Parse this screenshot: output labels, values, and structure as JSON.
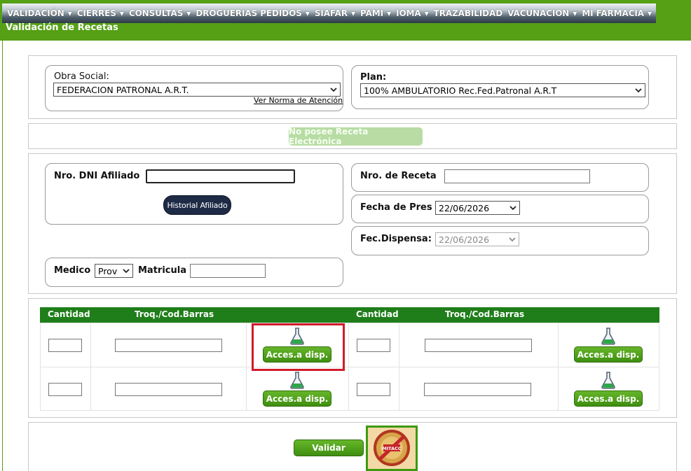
{
  "menu": [
    {
      "label": "VALIDACIÓN",
      "has_dropdown": true
    },
    {
      "label": "CIERRES",
      "has_dropdown": true
    },
    {
      "label": "CONSULTAS",
      "has_dropdown": true
    },
    {
      "label": "DROGUERIAS PEDIDOS",
      "has_dropdown": true
    },
    {
      "label": "SIAFAR",
      "has_dropdown": true
    },
    {
      "label": "PAMI",
      "has_dropdown": true
    },
    {
      "label": "IOMA",
      "has_dropdown": true
    },
    {
      "label": "TRAZABILIDAD",
      "has_dropdown": false
    },
    {
      "label": "VACUNACION",
      "has_dropdown": true
    },
    {
      "label": "MI FARMACIA",
      "has_dropdown": true
    }
  ],
  "page_title": "Validación de Recetas",
  "obra_social": {
    "label": "Obra Social:",
    "selected": "FEDERACION PATRONAL A.R.T.",
    "link": "Ver Norma de Atención"
  },
  "plan": {
    "label": "Plan:",
    "selected": "100% AMBULATORIO Rec.Fed.Patronal A.R.T"
  },
  "receta_electronica_button": "No posee Receta Electrónica",
  "afiliado": {
    "dni_label": "Nro. DNI Afiliado",
    "dni_value": "",
    "historial_button": "Historial Afiliado"
  },
  "receta": {
    "nro_label": "Nro. de Receta",
    "nro_value": "",
    "fecha_pres_label": "Fecha de Pres",
    "fecha_pres_value": "22/06/2026",
    "fec_dispensa_label": "Fec.Dispensa:",
    "fec_dispensa_value": "22/06/2026"
  },
  "medico": {
    "label": "Medico",
    "tipo_selected": "Prov",
    "matricula_label": "Matricula",
    "matricula_value": ""
  },
  "grid": {
    "headers": [
      "Cantidad",
      "Troq./Cod.Barras",
      "",
      "Cantidad",
      "Troq./Cod.Barras",
      ""
    ],
    "acces_button": "Acces.a disp.",
    "rows": [
      {
        "left": {
          "cantidad": "",
          "troquel": ""
        },
        "right": {
          "cantidad": "",
          "troquel": ""
        }
      },
      {
        "left": {
          "cantidad": "",
          "troquel": ""
        },
        "right": {
          "cantidad": "",
          "troquel": ""
        }
      }
    ]
  },
  "footer": {
    "validar_button": "Validar",
    "logo_text": "MITACC"
  },
  "colors": {
    "brand_green": "#55a015",
    "grid_header": "#1f7e1a",
    "button_green": "#4a9c19",
    "navy_button": "#1e2b47",
    "highlight_red": "#d11a2a"
  }
}
